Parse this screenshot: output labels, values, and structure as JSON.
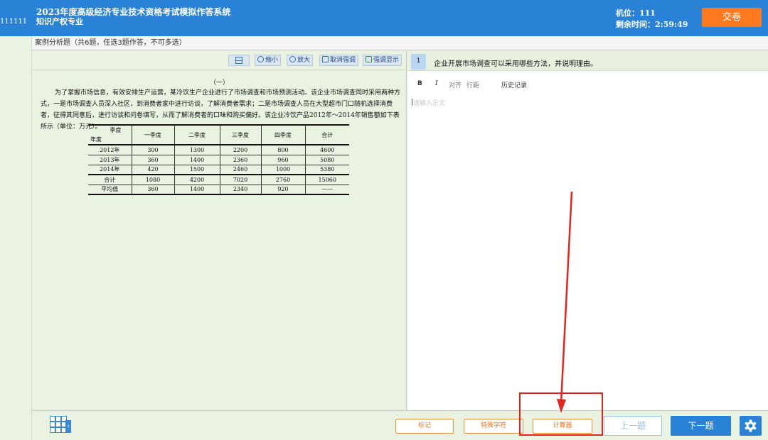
{
  "header": {
    "candidate_id": "111111",
    "title": "2023年度高级经济专业技术资格考试模拟作答系统",
    "subtitle": "知识产权专业",
    "seat_label": "机位：111",
    "remaining_label": "剩余时间：2:59:49",
    "submit_label": "交卷"
  },
  "instructions": "案例分析题（共6题，任选3题作答，不可多选）",
  "toolbar": {
    "shrink_label": "缩小",
    "enlarge_label": "放大",
    "cancel_highlight_label": "取消强调",
    "highlight_label": "强调显示"
  },
  "passage": {
    "heading": "（一）",
    "text": "为了掌握市场信息，有效安排生产运营，某冷饮生产企业进行了市场调查和市场预测活动。该企业市场调查同时采用两种方式，一是市场调查人员深入社区，到消费者家中进行访谈，了解消费者需求；二是市场调查人员在大型超市门口随机选择消费者，征得其同意后，进行访谈和问卷填写，从而了解消费者的口味和购买偏好。该企业冷饮产品2012年～2014年销售额如下表所示（单位：万元）。",
    "table": {
      "corner_top": "季度",
      "corner_bottom": "年度",
      "headers": [
        "一季度",
        "二季度",
        "三季度",
        "四季度",
        "合计"
      ],
      "rows": [
        {
          "label": "2012年",
          "cells": [
            "300",
            "1300",
            "2200",
            "800",
            "4600"
          ]
        },
        {
          "label": "2013年",
          "cells": [
            "360",
            "1400",
            "2360",
            "960",
            "5080"
          ]
        },
        {
          "label": "2014年",
          "cells": [
            "420",
            "1500",
            "2460",
            "1000",
            "5380"
          ]
        },
        {
          "label": "合计",
          "cells": [
            "1080",
            "4200",
            "7020",
            "2760",
            "15060"
          ]
        },
        {
          "label": "平均值",
          "cells": [
            "360",
            "1400",
            "2340",
            "920",
            "——"
          ]
        }
      ]
    }
  },
  "question": {
    "number": "1",
    "text": "企业开展市场调查可以采用哪些方法，并说明理由。"
  },
  "editor": {
    "bold": "B",
    "italic": "I",
    "align": "对齐",
    "line_spacing": "行距",
    "history": "历史记录",
    "placeholder": "请输入正文"
  },
  "bottom": {
    "mark_label": "标记",
    "special_chars_label": "特殊字符",
    "calculator_label": "计算器",
    "prev_label": "上一题",
    "next_label": "下一题"
  },
  "colors": {
    "header_blue": "#2a82d6",
    "submit_orange": "#ff7a1f",
    "panel_green": "#eaf3e1",
    "annotation_red": "#e0261d"
  }
}
